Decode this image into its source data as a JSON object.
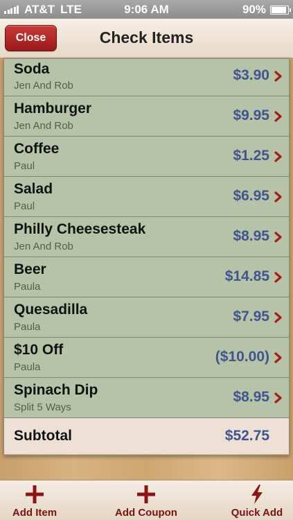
{
  "status_bar": {
    "carrier": "AT&T",
    "network": "LTE",
    "time": "9:06 AM",
    "battery_text": "90%",
    "battery_level": 0.9
  },
  "nav": {
    "close_label": "Close",
    "title": "Check Items"
  },
  "items": [
    {
      "name": "Soda",
      "who": "Jen And Rob",
      "price": "$3.90"
    },
    {
      "name": "Hamburger",
      "who": "Jen And Rob",
      "price": "$9.95"
    },
    {
      "name": "Coffee",
      "who": "Paul",
      "price": "$1.25"
    },
    {
      "name": "Salad",
      "who": "Paul",
      "price": "$6.95"
    },
    {
      "name": "Philly Cheesesteak",
      "who": "Jen And Rob",
      "price": "$8.95"
    },
    {
      "name": "Beer",
      "who": "Paula",
      "price": "$14.85"
    },
    {
      "name": "Quesadilla",
      "who": "Paula",
      "price": "$7.95"
    },
    {
      "name": "$10 Off",
      "who": "Paula",
      "price": "($10.00)"
    },
    {
      "name": "Spinach Dip",
      "who": "Split 5 Ways",
      "price": "$8.95"
    }
  ],
  "subtotal": {
    "label": "Subtotal",
    "value": "$52.75"
  },
  "toolbar": {
    "add_item": {
      "label": "Add Item",
      "icon": "plus-icon"
    },
    "add_coupon": {
      "label": "Add Coupon",
      "icon": "plus-icon"
    },
    "quick_add": {
      "label": "Quick Add",
      "icon": "lightning-icon"
    }
  },
  "colors": {
    "accent": "#8b1414",
    "price": "#415490",
    "row_bg": "#b6c3a6"
  }
}
